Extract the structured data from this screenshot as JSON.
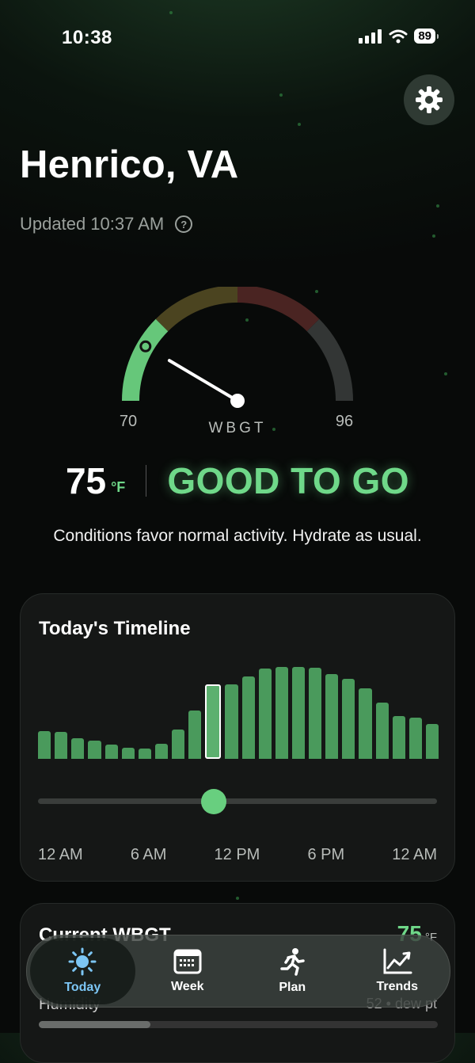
{
  "status_bar": {
    "time": "10:38",
    "battery": "89"
  },
  "location": {
    "city": "Henrico, VA",
    "updated": "Updated 10:37 AM"
  },
  "gauge": {
    "min_label": "70",
    "max_label": "96",
    "label": "WBGT",
    "value_fraction": 0.17
  },
  "reading": {
    "temp": "75",
    "unit": "°F",
    "status": "GOOD TO GO",
    "description": "Conditions favor normal activity. Hydrate as usual."
  },
  "timeline": {
    "title": "Today's Timeline",
    "ticks": [
      "12 AM",
      "6 AM",
      "12 PM",
      "6 PM",
      "12 AM"
    ],
    "bar_levels": [
      0.29,
      0.28,
      0.22,
      0.19,
      0.15,
      0.12,
      0.11,
      0.16,
      0.31,
      0.51,
      0.75,
      0.78,
      0.87,
      0.95,
      0.97,
      0.97,
      0.96,
      0.89,
      0.84,
      0.74,
      0.59,
      0.45,
      0.43,
      0.37
    ],
    "selected_index": 10,
    "slider_fraction": 0.44
  },
  "current_card": {
    "title": "Current WBGT",
    "value": "75",
    "unit": "°F",
    "humidity_label": "Humidity",
    "humidity_value": "52 • dew pt"
  },
  "tabs": [
    {
      "label": "Today",
      "icon": "sun-icon",
      "active": true
    },
    {
      "label": "Week",
      "icon": "calendar-icon",
      "active": false
    },
    {
      "label": "Plan",
      "icon": "runner-icon",
      "active": false
    },
    {
      "label": "Trends",
      "icon": "trend-chart-icon",
      "active": false
    }
  ],
  "colors": {
    "accent": "#6fd889",
    "bar": "#4a9a5c",
    "tab_active": "#7cc6f5"
  }
}
